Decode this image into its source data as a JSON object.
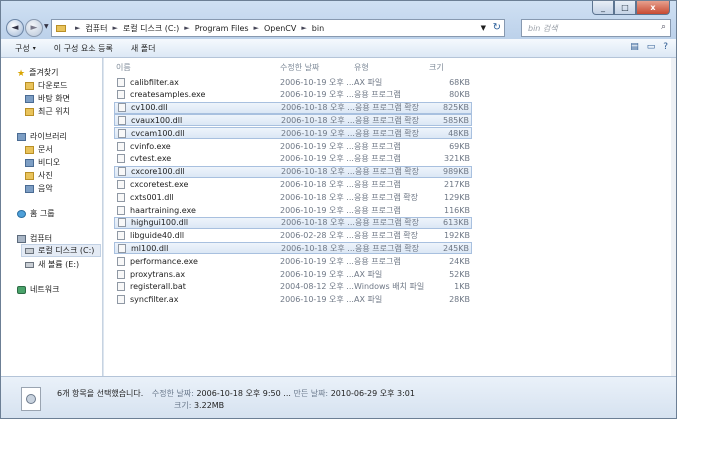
{
  "window": {
    "minimize": "_",
    "maximize": "□",
    "close": "x"
  },
  "address": {
    "crumbs": [
      "컴퓨터",
      "로컬 디스크 (C:)",
      "Program Files",
      "OpenCV",
      "bin"
    ],
    "back_glyph": "◄",
    "fwd_glyph": "►",
    "dropdown_glyph": "▼",
    "refresh_glyph": "↻"
  },
  "search": {
    "placeholder": "bin 검색",
    "icon": "search-icon"
  },
  "toolbar": {
    "organize": "구성",
    "burn": "이 구성 요소 등록",
    "new_folder": "새 폴더",
    "caret": "▾",
    "views": "▤",
    "preview": "▭",
    "help": "?"
  },
  "sidebar": {
    "favorites": "즐겨찾기",
    "downloads": "다운로드",
    "desktop": "바탕 화면",
    "recent": "최근 위치",
    "libraries": "라이브러리",
    "documents": "문서",
    "videos": "비디오",
    "pictures": "사진",
    "music": "음악",
    "homegroup": "홈 그룹",
    "computer": "컴퓨터",
    "local_disk": "로컬 디스크 (C:)",
    "new_volume": "새 볼륨 (E:)",
    "network": "네트워크"
  },
  "columns": {
    "name": "이름",
    "date": "수정한 날짜",
    "type": "유형",
    "size": "크기"
  },
  "files": [
    {
      "name": "calibfilter.ax",
      "date": "2006-10-19 오후 ...",
      "type": "AX 파일",
      "size": "68KB",
      "selected": false
    },
    {
      "name": "createsamples.exe",
      "date": "2006-10-19 오후 ...",
      "type": "응용 프로그램",
      "size": "80KB",
      "selected": false
    },
    {
      "name": "cv100.dll",
      "date": "2006-10-18 오후 ...",
      "type": "응용 프로그램 확장",
      "size": "825KB",
      "selected": true
    },
    {
      "name": "cvaux100.dll",
      "date": "2006-10-18 오후 ...",
      "type": "응용 프로그램 확장",
      "size": "585KB",
      "selected": true
    },
    {
      "name": "cvcam100.dll",
      "date": "2006-10-19 오후 ...",
      "type": "응용 프로그램 확장",
      "size": "48KB",
      "selected": true
    },
    {
      "name": "cvinfo.exe",
      "date": "2006-10-19 오후 ...",
      "type": "응용 프로그램",
      "size": "69KB",
      "selected": false
    },
    {
      "name": "cvtest.exe",
      "date": "2006-10-19 오후 ...",
      "type": "응용 프로그램",
      "size": "321KB",
      "selected": false
    },
    {
      "name": "cxcore100.dll",
      "date": "2006-10-18 오후 ...",
      "type": "응용 프로그램 확장",
      "size": "989KB",
      "selected": true
    },
    {
      "name": "cxcoretest.exe",
      "date": "2006-10-18 오후 ...",
      "type": "응용 프로그램",
      "size": "217KB",
      "selected": false
    },
    {
      "name": "cxts001.dll",
      "date": "2006-10-18 오후 ...",
      "type": "응용 프로그램 확장",
      "size": "129KB",
      "selected": false
    },
    {
      "name": "haartraining.exe",
      "date": "2006-10-19 오후 ...",
      "type": "응용 프로그램",
      "size": "116KB",
      "selected": false
    },
    {
      "name": "highgui100.dll",
      "date": "2006-10-18 오후 ...",
      "type": "응용 프로그램 확장",
      "size": "613KB",
      "selected": true
    },
    {
      "name": "libguide40.dll",
      "date": "2006-02-28 오후 ...",
      "type": "응용 프로그램 확장",
      "size": "192KB",
      "selected": false
    },
    {
      "name": "ml100.dll",
      "date": "2006-10-18 오후 ...",
      "type": "응용 프로그램 확장",
      "size": "245KB",
      "selected": true
    },
    {
      "name": "performance.exe",
      "date": "2006-10-19 오후 ...",
      "type": "응용 프로그램",
      "size": "24KB",
      "selected": false
    },
    {
      "name": "proxytrans.ax",
      "date": "2006-10-19 오후 ...",
      "type": "AX 파일",
      "size": "52KB",
      "selected": false
    },
    {
      "name": "registerall.bat",
      "date": "2004-08-12 오후 ...",
      "type": "Windows 배치 파일",
      "size": "1KB",
      "selected": false
    },
    {
      "name": "syncfilter.ax",
      "date": "2006-10-19 오후 ...",
      "type": "AX 파일",
      "size": "28KB",
      "selected": false
    }
  ],
  "details": {
    "count": "6개 항목을 선택했습니다.",
    "modified_label": "수정한 날짜:",
    "modified_value": "2006-10-18 오후 9:50 ...",
    "created_label": "만든 날짜:",
    "created_value": "2010-06-29 오후 3:01",
    "size_label": "크기:",
    "size_value": "3.22MB"
  }
}
